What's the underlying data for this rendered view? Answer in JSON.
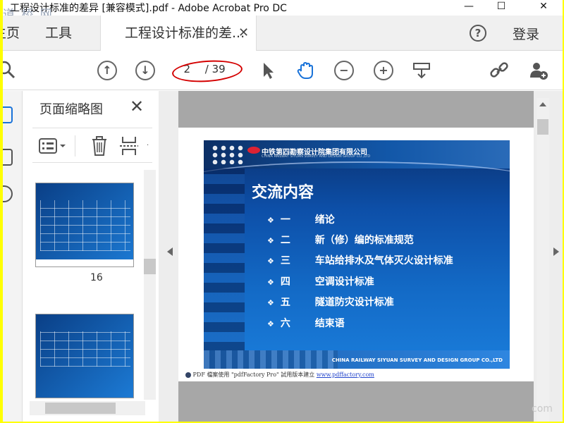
{
  "window": {
    "title": "工程设计标准的差异 [兼容模式].pdf - Adobe Acrobat Pro DC",
    "minimize": "—",
    "maximize": "☐",
    "close": "✕",
    "watermark": "道 桥 网"
  },
  "tabs": {
    "home": "主页",
    "tools": "工具",
    "document": "工程设计标准的差...",
    "close": "✕",
    "help": "?",
    "login": "登录"
  },
  "toolbar": {
    "current_page": "2",
    "total_pages": "/ 39"
  },
  "thumbnail_panel": {
    "title": "页面缩略图",
    "close": "✕",
    "thumbnails": [
      {
        "label": "16"
      },
      {
        "label": ""
      }
    ]
  },
  "slide": {
    "company_cn": "中铁第四勘察设计院集团有限公司",
    "company_en": "CHINA RAILWAY SIYUAN SURVEY AND DESIGN GROUP CO.,LTD",
    "title": "交流内容",
    "items": [
      {
        "bullet": "❖",
        "num": "一",
        "text": "绪论"
      },
      {
        "bullet": "❖",
        "num": "二",
        "text": "新（修）编的标准规范"
      },
      {
        "bullet": "❖",
        "num": "三",
        "text": "车站给排水及气体灭火设计标准"
      },
      {
        "bullet": "❖",
        "num": "四",
        "text": "空调设计标准"
      },
      {
        "bullet": "❖",
        "num": "五",
        "text": "隧道防灾设计标准"
      },
      {
        "bullet": "❖",
        "num": "六",
        "text": "结束语"
      }
    ],
    "footer": "CHINA RAILWAY SIYUAN SURVEY AND DESIGN GROUP CO.,LTD"
  },
  "pdf_note": {
    "text": "PDF 檔案使用 \"pdfFactory Pro\" 試用版本建立 ",
    "link": "www.pdffactory.com"
  },
  "corner_watermark": "com",
  "colors": {
    "annotation_ellipse": "#d40000",
    "slide_blue": "#136ac6",
    "border": "#ffff00"
  }
}
